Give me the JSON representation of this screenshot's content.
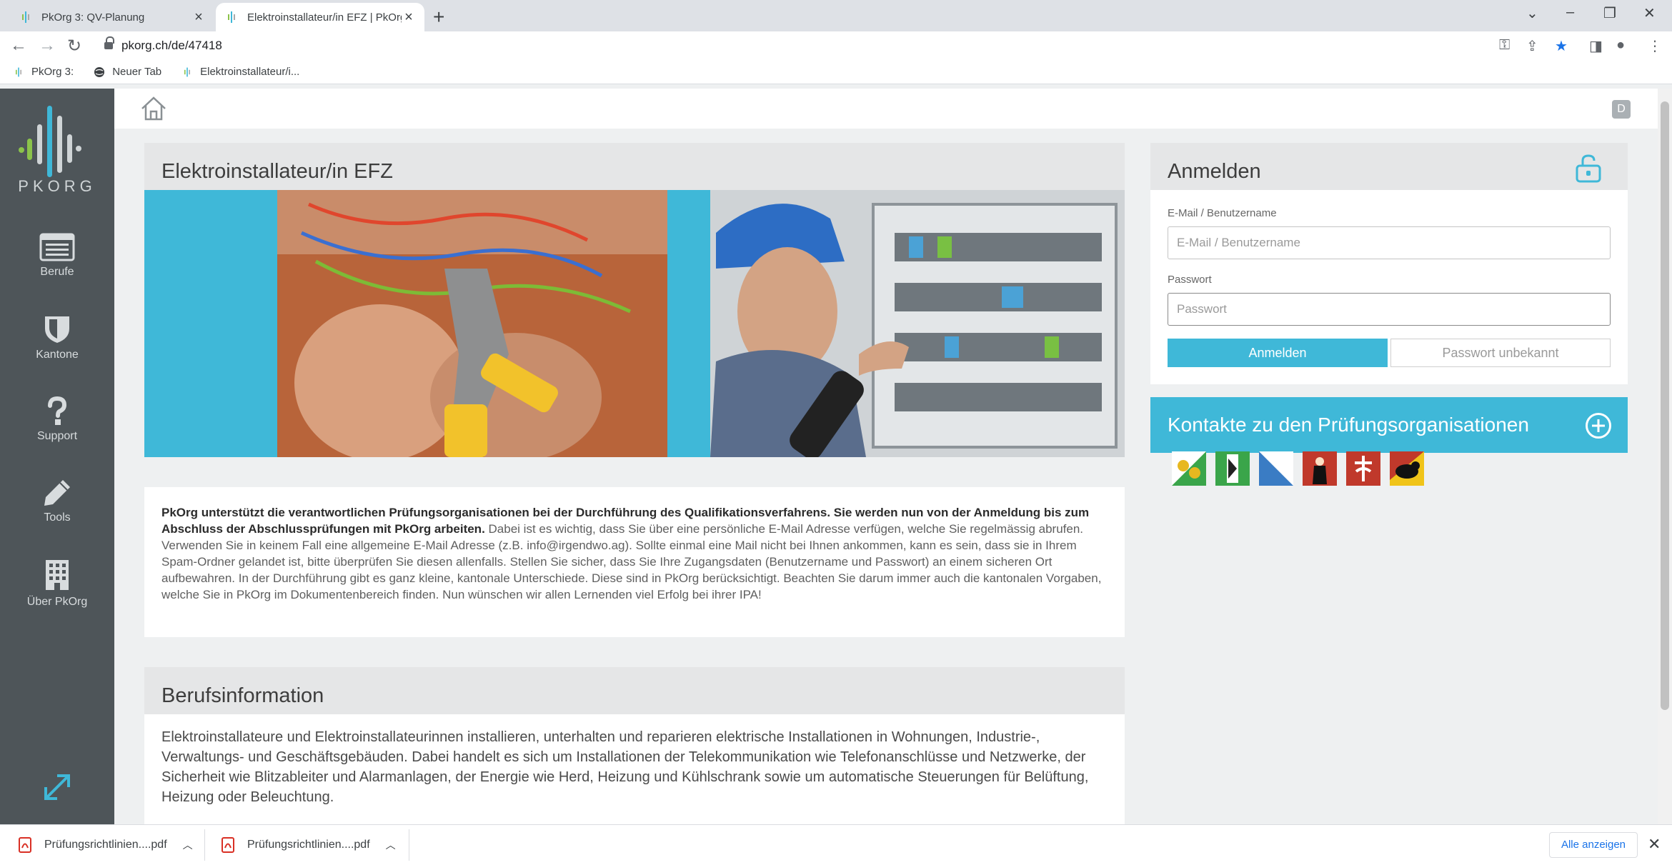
{
  "browser": {
    "tabs": [
      {
        "title": "PkOrg 3: QV-Planung",
        "active": false
      },
      {
        "title": "Elektroinstallateur/in EFZ | PkOrg",
        "active": true
      }
    ],
    "url": "pkorg.ch/de/47418",
    "bookmarks": [
      "PkOrg 3:",
      "Neuer Tab",
      "Elektroinstallateur/i..."
    ]
  },
  "sidebar": {
    "logo_text": "PKORG",
    "items": [
      {
        "label": "Berufe",
        "icon": "list-icon"
      },
      {
        "label": "Kantone",
        "icon": "shield-icon"
      },
      {
        "label": "Support",
        "icon": "question-icon"
      },
      {
        "label": "Tools",
        "icon": "pencil-icon"
      },
      {
        "label": "Über PkOrg",
        "icon": "building-icon"
      }
    ]
  },
  "topbar": {
    "user_initial": "D"
  },
  "main": {
    "title": "Elektroinstallateur/in EFZ",
    "intro_bold": "PkOrg unterstützt die verantwortlichen Prüfungsorganisationen bei der Durchführung des Qualifikationsverfahrens. Sie werden nun von der Anmeldung bis zum Abschluss der Abschlussprüfungen mit PkOrg arbeiten.",
    "intro_text": " Dabei ist es wichtig, dass Sie über eine persönliche E-Mail Adresse verfügen, welche Sie regelmässig abrufen. Verwenden Sie in keinem Fall eine allgemeine E-Mail Adresse (z.B. info@irgendwo.ag). Sollte einmal eine Mail nicht bei Ihnen ankommen, kann es sein, dass sie in Ihrem Spam-Ordner gelandet ist, bitte überprüfen Sie diesen allenfalls. Stellen Sie sicher, dass Sie Ihre Zugangsdaten (Benutzername und Passwort) an einem sicheren Ort aufbewahren. In der Durchführung gibt es ganz kleine, kantonale Unterschiede. Diese sind in PkOrg berücksichtigt. Beachten Sie darum immer auch die kantonalen Vorgaben, welche Sie in PkOrg im Dokumentenbereich finden. Nun wünschen wir allen Lernenden viel Erfolg bei ihrer IPA!",
    "berufsinfo_title": "Berufsinformation",
    "berufsinfo_text": "Elektroinstallateure und Elektroinstallateurinnen installieren, unterhalten und reparieren elektrische Installationen in Wohnungen, Industrie-, Verwaltungs- und Geschäftsgebäuden. Dabei handelt es sich um Installationen der Telekommunikation wie Telefonanschlüsse und Netzwerke, der Sicherheit wie Blitzableiter und Alarmanlagen, der Energie wie Herd, Heizung und Kühlschrank sowie um automatische Steuerungen für Belüftung, Heizung oder Beleuchtung."
  },
  "login": {
    "title": "Anmelden",
    "email_label": "E-Mail / Benutzername",
    "email_placeholder": "E-Mail / Benutzername",
    "password_label": "Passwort",
    "password_placeholder": "Passwort",
    "submit_label": "Anmelden",
    "forgot_label": "Passwort unbekannt"
  },
  "contacts": {
    "title": "Kontakte zu den Prüfungsorganisationen"
  },
  "crests": [
    "thurgau-crest",
    "appenzell-ar-crest",
    "zurich-crest",
    "schwyz-crest",
    "neuchatel-crest",
    "bern-crest"
  ],
  "downloads": {
    "items": [
      "Prüfungsrichtlinien....pdf",
      "Prüfungsrichtlinien....pdf"
    ],
    "show_all": "Alle anzeigen"
  },
  "colors": {
    "accent": "#3fb8d8",
    "sidebar": "#4e5559",
    "panel_head": "#e5e6e7"
  }
}
